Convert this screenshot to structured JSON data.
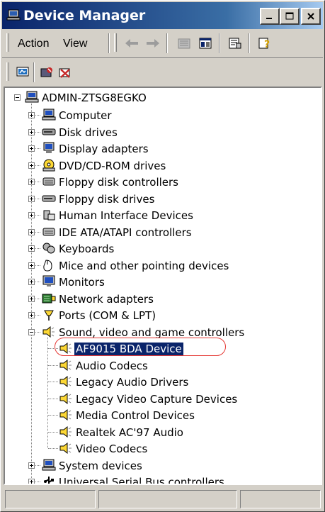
{
  "window": {
    "title": "Device Manager"
  },
  "menu": {
    "action": "Action",
    "view": "View"
  },
  "tree": {
    "root": "ADMIN-ZTSG8EGKO",
    "categories": [
      {
        "label": "Computer",
        "icon": "computer-icon",
        "expanded": false
      },
      {
        "label": "Disk drives",
        "icon": "disk-drive-icon",
        "expanded": false
      },
      {
        "label": "Display adapters",
        "icon": "display-adapter-icon",
        "expanded": false
      },
      {
        "label": "DVD/CD-ROM drives",
        "icon": "dvd-drive-icon",
        "expanded": false
      },
      {
        "label": "Floppy disk controllers",
        "icon": "floppy-controller-icon",
        "expanded": false
      },
      {
        "label": "Floppy disk drives",
        "icon": "floppy-drive-icon",
        "expanded": false
      },
      {
        "label": "Human Interface Devices",
        "icon": "hid-icon",
        "expanded": false
      },
      {
        "label": "IDE ATA/ATAPI controllers",
        "icon": "ide-controller-icon",
        "expanded": false
      },
      {
        "label": "Keyboards",
        "icon": "keyboard-icon",
        "expanded": false
      },
      {
        "label": "Mice and other pointing devices",
        "icon": "mouse-icon",
        "expanded": false
      },
      {
        "label": "Monitors",
        "icon": "monitor-icon",
        "expanded": false
      },
      {
        "label": "Network adapters",
        "icon": "network-adapter-icon",
        "expanded": false
      },
      {
        "label": "Ports (COM & LPT)",
        "icon": "port-icon",
        "expanded": false
      },
      {
        "label": "Sound, video and game controllers",
        "icon": "sound-icon",
        "expanded": true
      },
      {
        "label": "System devices",
        "icon": "system-device-icon",
        "expanded": false
      },
      {
        "label": "Universal Serial Bus controllers",
        "icon": "usb-icon",
        "expanded": false
      }
    ],
    "sound_children": [
      {
        "label": "AF9015 BDA Device",
        "selected": true
      },
      {
        "label": "Audio Codecs"
      },
      {
        "label": "Legacy Audio Drivers"
      },
      {
        "label": "Legacy Video Capture Devices"
      },
      {
        "label": "Media Control Devices"
      },
      {
        "label": "Realtek AC'97 Audio"
      },
      {
        "label": "Video Codecs"
      }
    ]
  },
  "colors": {
    "highlight_ring": "#e53935",
    "selection": "#0a246a",
    "titlebar": "#0a246a"
  }
}
